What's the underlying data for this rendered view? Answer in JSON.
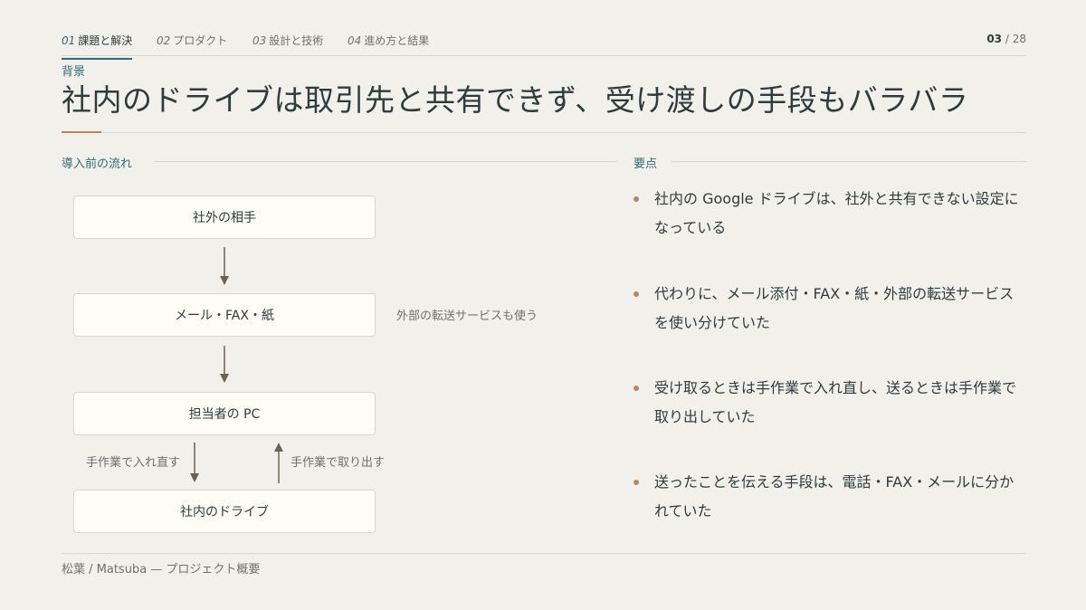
{
  "nav": {
    "tabs": [
      {
        "num": "01",
        "label": "課題と解決"
      },
      {
        "num": "02",
        "label": "プロダクト"
      },
      {
        "num": "03",
        "label": "設計と技術"
      },
      {
        "num": "04",
        "label": "進め方と結果"
      }
    ],
    "active_tab": 0,
    "page_current": "03",
    "page_total": "/ 28"
  },
  "header": {
    "kicker": "背景",
    "title": "社内のドライブは取引先と共有できず、受け渡しの手段もバラバラ"
  },
  "flow": {
    "heading": "導入前の流れ",
    "boxes": [
      "社外の相手",
      "メール・FAX・紙",
      "担当者の PC",
      "社内のドライブ"
    ],
    "side_note": "外部の転送サービスも使う",
    "down_label": "手作業で入れ直す",
    "up_label": "手作業で取り出す"
  },
  "points": {
    "heading": "要点",
    "items": [
      "社内の Google ドライブは、社外と共有できない設定になっている",
      "代わりに、メール添付・FAX・紙・外部の転送サービスを使い分けていた",
      "受け取るときは手作業で入れ直し、送るときは手作業で取り出していた",
      "送ったことを伝える手段は、電話・FAX・メールに分かれていた"
    ]
  },
  "footer": {
    "text": "松葉 / Matsuba — プロジェクト概要"
  },
  "colors": {
    "accent": "#2f6b78",
    "bullet": "#b8875a",
    "background": "#f2f0eb"
  }
}
